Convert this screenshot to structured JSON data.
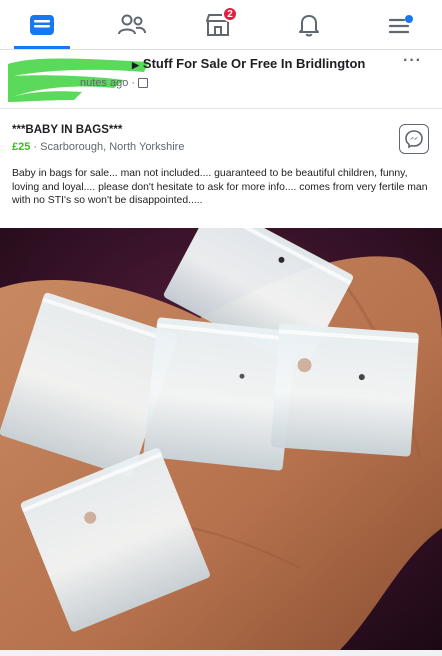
{
  "nav": {
    "items": [
      {
        "name": "home",
        "icon": "home-card-icon",
        "active": true
      },
      {
        "name": "friends",
        "icon": "friends-icon"
      },
      {
        "name": "marketplace",
        "icon": "marketplace-icon",
        "badge": "2"
      },
      {
        "name": "notifications",
        "icon": "bell-icon"
      },
      {
        "name": "menu",
        "icon": "hamburger-menu-icon"
      }
    ],
    "accent": "#1877f2",
    "badge_color": "#e41e3f"
  },
  "post": {
    "group_name": "Stuff For Sale Or Free In Bridlington",
    "time_text": "nutes ago ·",
    "more_label": "···"
  },
  "listing": {
    "title": "***BABY IN BAGS***",
    "price": "£25",
    "location": " · Scarborough, North Yorkshire",
    "price_color": "#42b72a",
    "description": "Baby in bags for sale... man not included.... guaranteed to be beautiful children, funny, loving and loyal.... please don't hesitate to ask for more info.... comes from very fertile man with no STI's so won't be disappointed....."
  }
}
